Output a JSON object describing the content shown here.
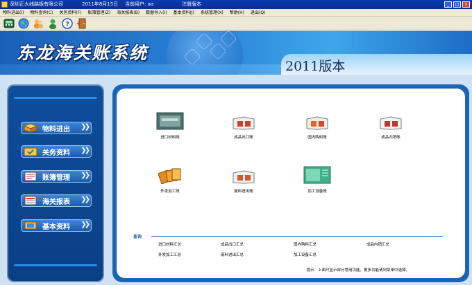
{
  "titlebar": {
    "company": "深圳正大线路板有限公司",
    "date": "2011年8月15日",
    "user_label": "当前用户: aa",
    "registered": "注册版本"
  },
  "menu": [
    "物料进出(I)",
    "物料查询(C)",
    "关务资料(F)",
    "账簿管理(Z)",
    "海关报表(B)",
    "数据导入(I)",
    "基本资料(J)",
    "系统管理(X)",
    "帮助(H)",
    "退出(Q)"
  ],
  "banner": {
    "title": "东龙海关账系统",
    "version": "2011版本"
  },
  "nav": [
    {
      "label": "物料进出"
    },
    {
      "label": "关务资料"
    },
    {
      "label": "账簿管理"
    },
    {
      "label": "海关报表"
    },
    {
      "label": "基本资料"
    }
  ],
  "modules": [
    {
      "label": "进口材料账"
    },
    {
      "label": "成品出口账"
    },
    {
      "label": "国内购料账"
    },
    {
      "label": "成品内销账"
    },
    {
      "label": "外发加工账"
    },
    {
      "label": "废料进出账"
    },
    {
      "label": "加工设备账"
    }
  ],
  "query": {
    "title": "查询",
    "links": [
      "进口材料汇总",
      "成品出口汇总",
      "国内购料汇总",
      "成品内销汇总",
      "外发加工汇总",
      "废料进出汇总",
      "加工设备汇总"
    ]
  },
  "hint": "提示：上面只显示部分常用功能，更多功能请到菜单中选择。",
  "colors": {
    "accent": "#1b63b5",
    "nav_bg": "#0e4e9c",
    "banner": "#2a84d9"
  }
}
